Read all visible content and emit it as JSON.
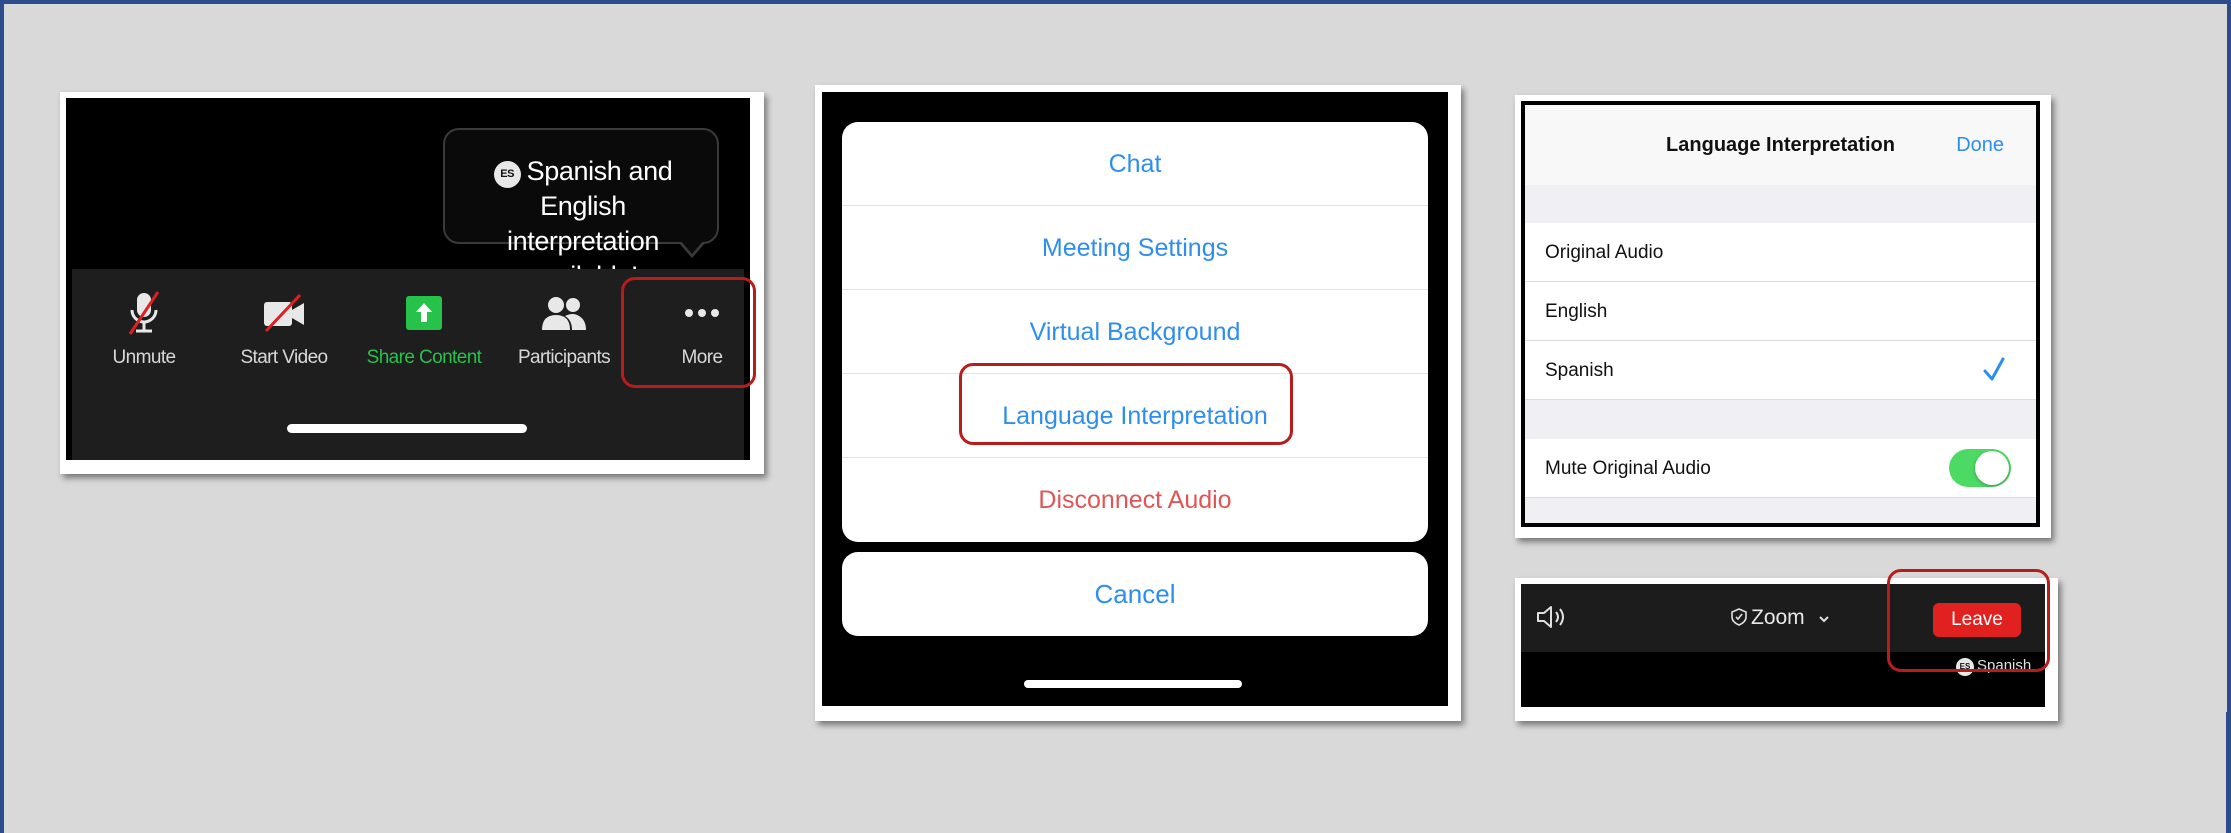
{
  "toolbar_panel": {
    "bubble": {
      "badge": "ES",
      "line1": "Spanish and English",
      "line2": "interpretation available!"
    },
    "items": [
      {
        "label": "Unmute",
        "icon": "microphone-muted-icon"
      },
      {
        "label": "Start Video",
        "icon": "video-off-icon"
      },
      {
        "label": "Share Content",
        "icon": "share-screen-icon"
      },
      {
        "label": "Participants",
        "icon": "participants-icon"
      },
      {
        "label": "More",
        "icon": "more-dots-icon"
      }
    ]
  },
  "menu_panel": {
    "items": [
      "Chat",
      "Meeting Settings",
      "Virtual Background",
      "Language Interpretation",
      "Disconnect Audio"
    ],
    "cancel": "Cancel"
  },
  "settings_panel": {
    "title": "Language Interpretation",
    "done": "Done",
    "options": [
      "Original Audio",
      "English",
      "Spanish"
    ],
    "selected": "Spanish",
    "mute_label": "Mute Original Audio",
    "mute_on": true
  },
  "meeting_bar": {
    "app_label": "Zoom",
    "leave": "Leave",
    "language_badge": "ES",
    "language_label": "Spanish"
  },
  "colors": {
    "highlight": "#b81d1d",
    "link_blue": "#2e8ef0",
    "danger_red": "#e25555",
    "leave_red": "#e0211f",
    "share_green": "#27c24a",
    "toggle_green": "#4cd964",
    "frame_blue": "#2e4b8c"
  }
}
